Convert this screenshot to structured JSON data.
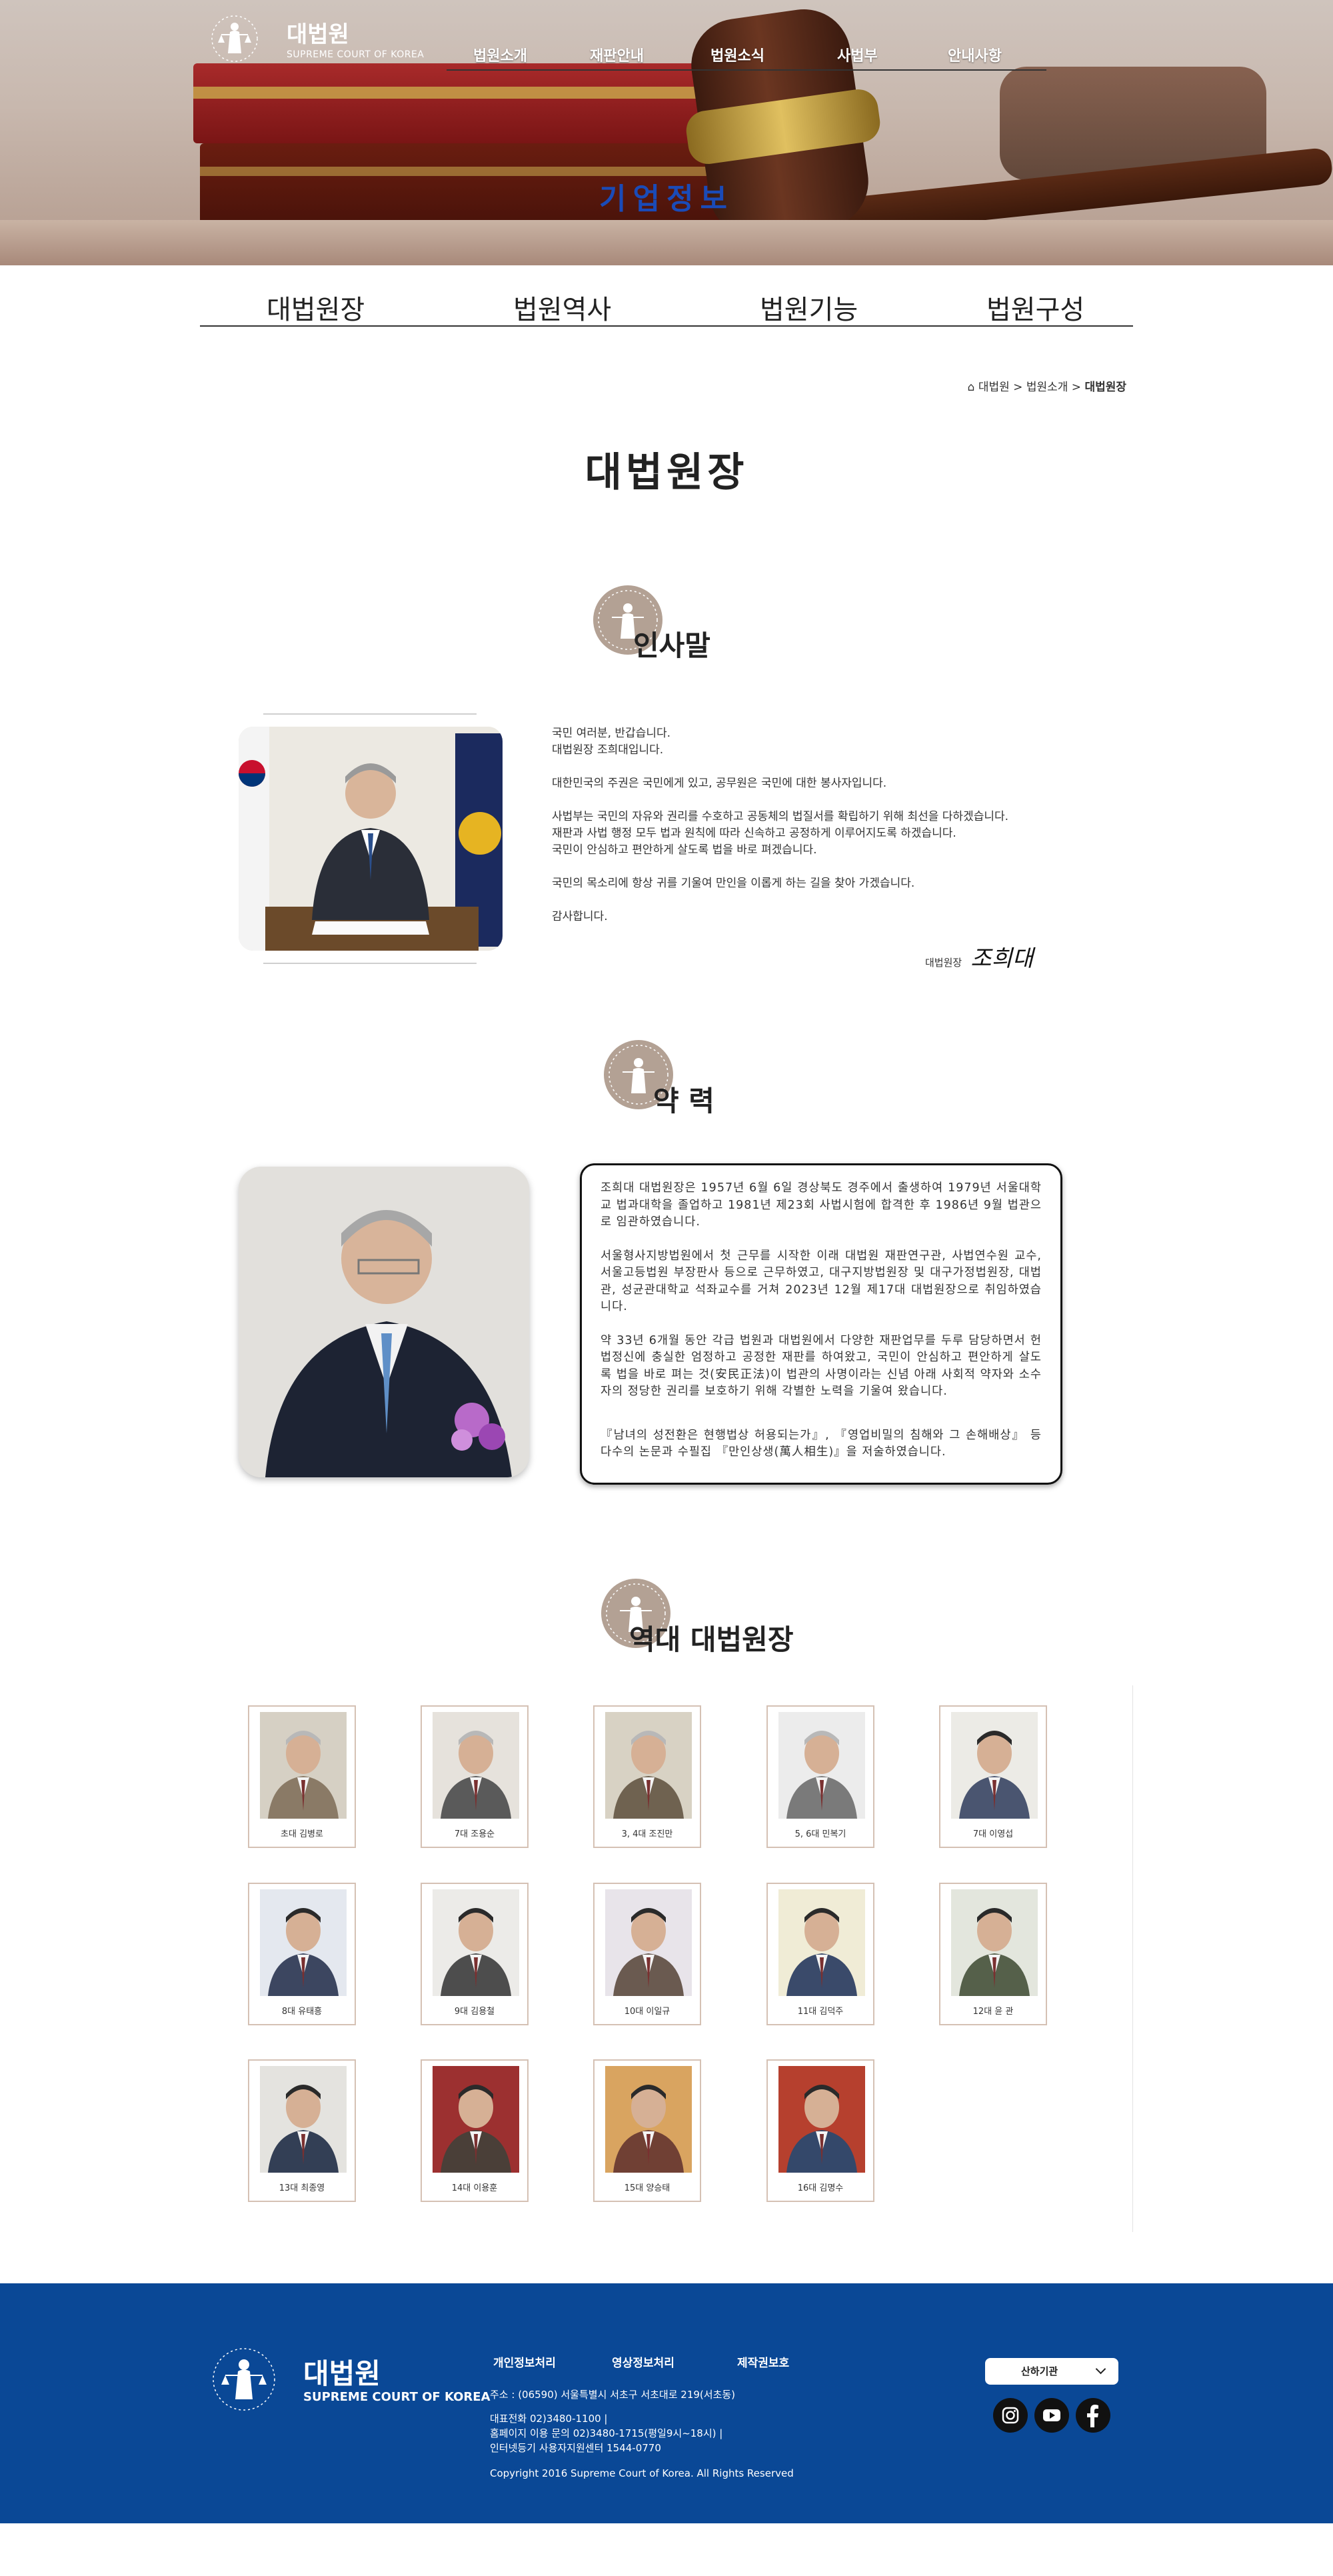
{
  "header": {
    "logo_name": "대법원",
    "logo_sub": "SUPREME COURT OF KOREA",
    "nav": [
      "법원소개",
      "재판안내",
      "법원소식",
      "사법부",
      "안내사항"
    ],
    "hero_title": "기업정보"
  },
  "subtabs": [
    "대법원장",
    "법원역사",
    "법원기능",
    "법원구성"
  ],
  "breadcrumb": {
    "home": "대법원",
    "sep": ">",
    "level1": "법원소개",
    "current": "대법원장"
  },
  "page_title": "대법원장",
  "greeting": {
    "title": "인사말",
    "paragraphs": [
      "국민 여러분, 반갑습니다.\n대법원장 조희대입니다.",
      "대한민국의 주권은 국민에게 있고, 공무원은 국민에 대한 봉사자입니다.",
      "사법부는 국민의 자유와 권리를 수호하고 공동체의 법질서를 확립하기 위해 최선을 다하겠습니다.\n재판과 사법 행정 모두 법과 원칙에 따라 신속하고 공정하게 이루어지도록 하겠습니다.\n국민이 안심하고 편안하게 살도록 법을 바로 펴겠습니다.",
      "국민의 목소리에 항상 귀를 기울여 만인을 이롭게 하는 길을 찾아 가겠습니다.",
      "감사합니다."
    ],
    "sign_label": "대법원장",
    "sign_name": "조희대"
  },
  "career": {
    "title": "약 력",
    "paragraphs": [
      "조희대 대법원장은 1957년 6월 6일 경상북도 경주에서 출생하여 1979년 서울대학교 법과대학을 졸업하고 1981년 제23회 사법시험에 합격한 후 1986년 9월 법관으로 임관하였습니다.",
      "서울형사지방법원에서 첫 근무를 시작한 이래 대법원 재판연구관, 사법연수원 교수, 서울고등법원 부장판사 등으로 근무하였고, 대구지방법원장 및 대구가정법원장, 대법관, 성균관대학교 석좌교수를 거쳐 2023년 12월 제17대 대법원장으로 취임하였습니다.",
      "약 33년 6개월 동안 각급 법원과 대법원에서 다양한 재판업무를 두루 담당하면서 헌법정신에 충실한 엄정하고 공정한 재판를 하여왔고, 국민이 안심하고 편안하게 살도록 법을 바로 펴는 것(安民正法)이 법관의 사명이라는 신념 아래 사회적 약자와 소수자의 정당한 권리를 보호하기 위해 각별한 노력을 기울여 왔습니다.",
      "『남녀의 성전환은 현행법상 허용되는가』, 『영업비밀의 침해와 그 손해배상』 등 다수의 논문과 수필집 『만인상생(萬人相生)』을 저술하였습니다."
    ]
  },
  "past_chiefs": {
    "title": "역대 대법원장",
    "items": [
      "초대 김병로",
      "7대 조용순",
      "3, 4대 조진만",
      "5, 6대 민복기",
      "7대 이영섭",
      "8대 유태흥",
      "9대 김용철",
      "10대 이일규",
      "11대 김덕주",
      "12대 윤 관",
      "13대 최종영",
      "14대 이용훈",
      "15대 양승태",
      "16대 김명수"
    ]
  },
  "footer": {
    "logo_name": "대법원",
    "logo_sub": "SUPREME COURT OF KOREA",
    "links": [
      "개인정보처리",
      "영상정보처리",
      "제작권보호"
    ],
    "address": "주소 : (06590) 서울특별시 서초구 서초대로 219(서초동)",
    "phone": "대표전화 02)3480-1100  |",
    "homepage_inquiry": "홈페이지 이용 문의 02)3480-1715(평일9시~18시)  |",
    "internet_center": "인터넷등기 사용자지원센터 1544-0770",
    "copyright": "Copyright 2016 Supreme Court of Korea. All Rights Reserved",
    "select_label": "산하기관",
    "sns": [
      "instagram-icon",
      "youtube-icon",
      "facebook-icon"
    ]
  },
  "colors": {
    "hero_title": "#1a4bb8",
    "footer_bg": "#0a4896",
    "emblem": "#b3a194"
  }
}
